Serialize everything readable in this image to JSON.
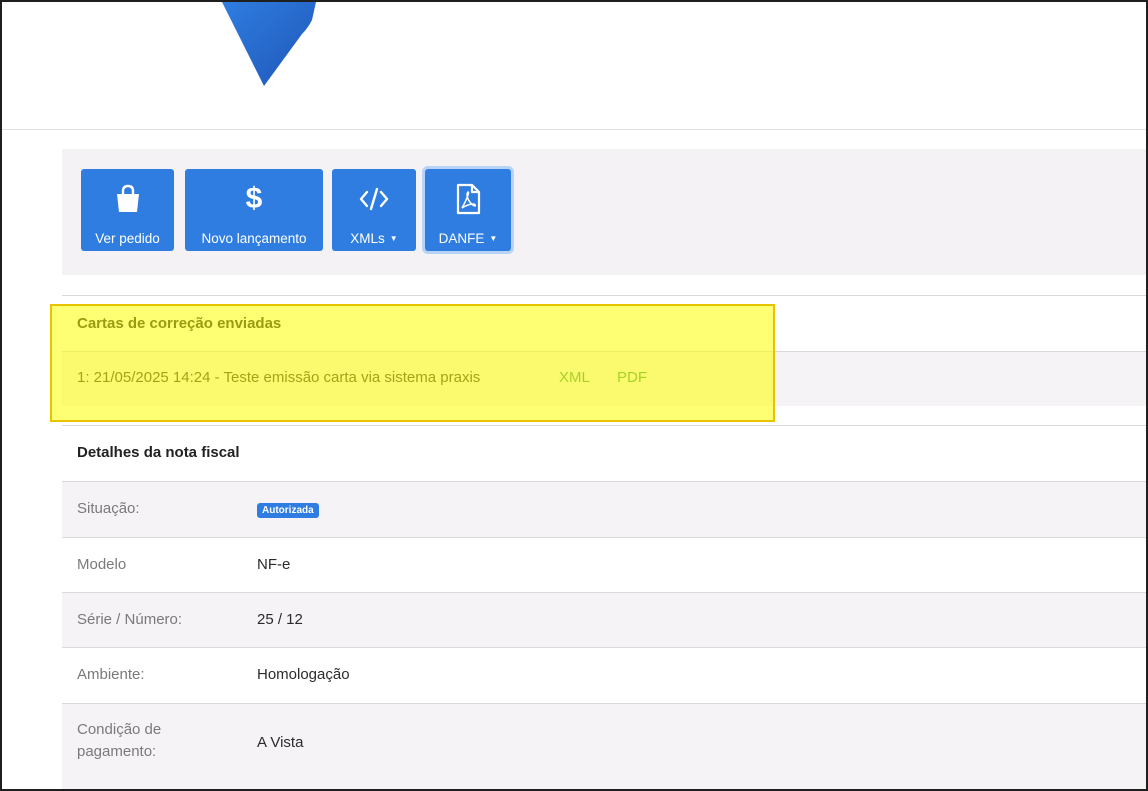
{
  "toolbar": {
    "ver_pedido": "Ver pedido",
    "novo_lancamento": "Novo lançamento",
    "xmls": "XMLs",
    "danfe": "DANFE",
    "dollar_glyph": "$"
  },
  "cartas": {
    "title": "Cartas de correção enviadas",
    "entry_text": "1: 21/05/2025 14:24 - Teste emissão carta via sistema praxis",
    "xml_link": "XML",
    "pdf_link": "PDF"
  },
  "detalhes": {
    "title": "Detalhes da nota fiscal",
    "situacao_label": "Situação:",
    "situacao_badge": "Autorizada",
    "modelo_label": "Modelo",
    "modelo_value": "NF-e",
    "serie_label": "Série / Número:",
    "serie_value": "25 / 12",
    "ambiente_label": "Ambiente:",
    "ambiente_value": "Homologação",
    "condicao_label_1": "Condição de",
    "condicao_label_2": "pagamento:",
    "condicao_value": "A Vista"
  },
  "colors": {
    "primary": "#2f7de0",
    "link_green": "#3f9a5a",
    "highlight": "#ffff00",
    "row_alt": "#f6f3f6"
  },
  "icons": [
    "logo-icon",
    "shopping-bag-icon",
    "dollar-icon",
    "code-icon",
    "pdf-file-icon",
    "caret-down-icon"
  ]
}
